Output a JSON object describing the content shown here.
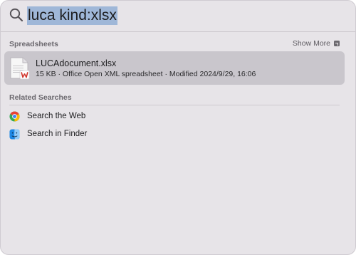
{
  "search": {
    "query": "luca kind:xlsx"
  },
  "sections": {
    "spreadsheets_title": "Spreadsheets",
    "show_more_label": "Show More",
    "related_title": "Related Searches"
  },
  "result": {
    "name": "LUCAdocument.xlsx",
    "meta": "15 KB · Office Open XML spreadsheet · Modified 2024/9/29, 16:06",
    "icon": "xlsx-file-icon"
  },
  "related": [
    {
      "label": "Search the Web",
      "icon": "chrome-icon"
    },
    {
      "label": "Search in Finder",
      "icon": "finder-icon"
    }
  ],
  "colors": {
    "selection": "#9fb7d8",
    "row_highlight": "#c9c6cc",
    "panel_bg": "#e7e4e8"
  }
}
